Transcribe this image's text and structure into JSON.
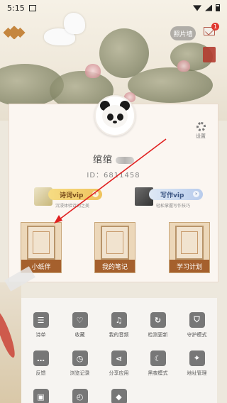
{
  "status_bar": {
    "time": "5:15"
  },
  "header": {
    "photo_wall_label": "照片墙",
    "mail_badge": "1"
  },
  "profile": {
    "username": "绾绾",
    "user_id": "ID：6811458",
    "settings_label": "设置"
  },
  "vip": {
    "poetry": {
      "title": "诗词vip",
      "subtitle": "沉浸体验诗词之美"
    },
    "writing": {
      "title": "写作vip",
      "subtitle": "轻松掌握写作技巧"
    }
  },
  "features": [
    {
      "label": "小纸伴"
    },
    {
      "label": "我的笔记"
    },
    {
      "label": "学习计划"
    }
  ],
  "menu": [
    {
      "label": "诗单",
      "icon": "list-icon"
    },
    {
      "label": "收藏",
      "icon": "heart-icon"
    },
    {
      "label": "我的音频",
      "icon": "music-icon"
    },
    {
      "label": "检测更新",
      "icon": "refresh-icon"
    },
    {
      "label": "守护模式",
      "icon": "shield-icon"
    },
    {
      "label": "反馈",
      "icon": "chat-icon"
    },
    {
      "label": "浏览记录",
      "icon": "history-icon"
    },
    {
      "label": "分享应用",
      "icon": "share-icon"
    },
    {
      "label": "黑夜模式",
      "icon": "moon-icon"
    },
    {
      "label": "地址管理",
      "icon": "location-icon"
    },
    {
      "label": "",
      "icon": "gift-icon"
    },
    {
      "label": "",
      "icon": "timer-icon"
    },
    {
      "label": "",
      "icon": "diamond-icon"
    }
  ],
  "colors": {
    "accent_brown": "#a5602d",
    "badge_red": "#e0372f",
    "annotation_red": "#e02020"
  }
}
